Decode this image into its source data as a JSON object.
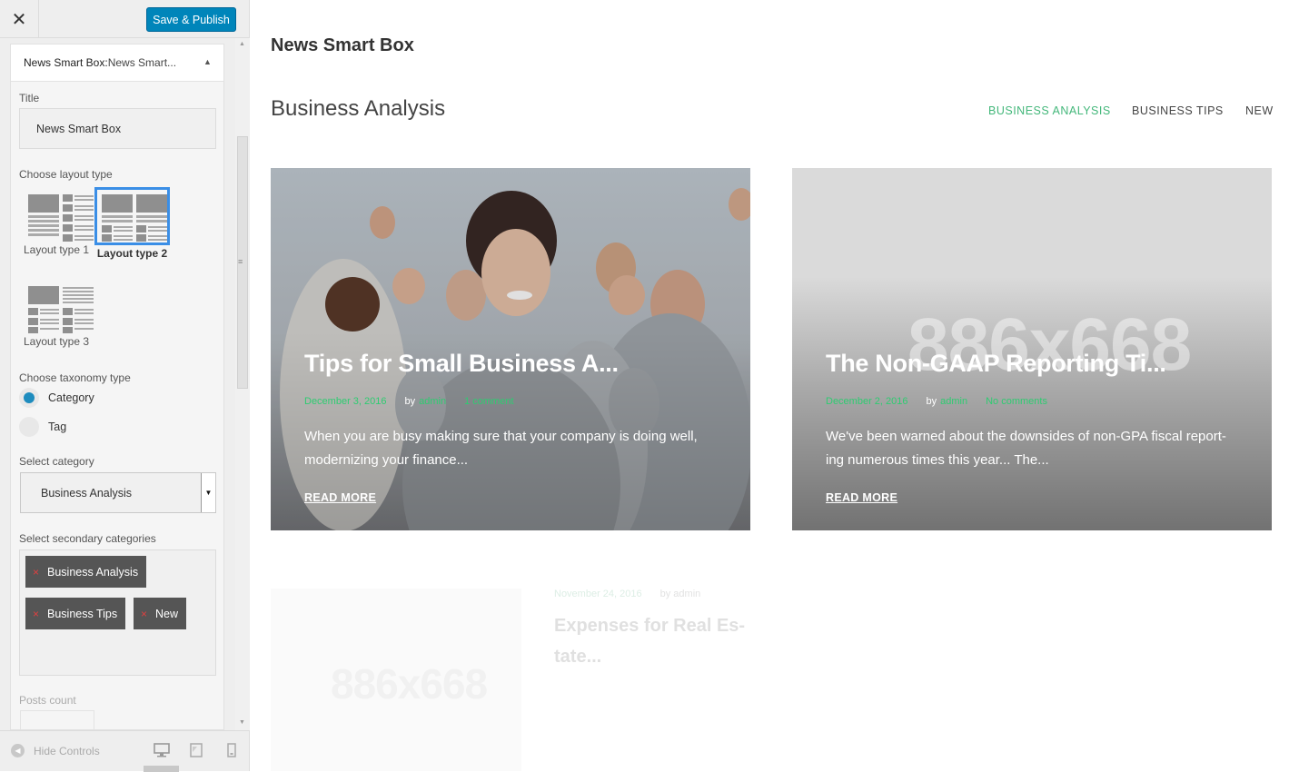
{
  "customizer": {
    "close_icon": "close-icon",
    "publish_label": "Save & Publish",
    "panel_title_bold": "News Smart Box:",
    "panel_title_rest": " News Smart...",
    "title_label": "Title",
    "title_value": "News Smart Box",
    "layout_label": "Choose layout type",
    "layouts": [
      {
        "label": "Layout type 1",
        "selected": false
      },
      {
        "label": "Layout type 2",
        "selected": true
      },
      {
        "label": "Layout type 3",
        "selected": false
      }
    ],
    "taxonomy_label": "Choose taxonomy type",
    "taxonomy_options": [
      {
        "label": "Category",
        "checked": true
      },
      {
        "label": "Tag",
        "checked": false
      }
    ],
    "category_label": "Select category",
    "category_value": "Business Analysis",
    "secondary_label": "Select secondary categories",
    "secondary_tags": [
      "Business Analysis",
      "Business Tips",
      "New"
    ],
    "posts_count_label": "Posts count",
    "hide_controls_label": "Hide Controls"
  },
  "preview": {
    "widget_title": "News Smart Box",
    "section_title": "Business Analysis",
    "tabs": [
      "BUSINESS ANALYSIS",
      "BUSINESS TIPS",
      "NEW"
    ],
    "active_tab_color": "#43b77a",
    "posts": [
      {
        "title": "Tips for Small Business A...",
        "date": "December 3, 2016",
        "by": "by",
        "author": "admin",
        "comments": "1 comment",
        "excerpt": "When you are busy making sure that your company is doing well, modernizing your finance...",
        "read_more": "READ MORE"
      },
      {
        "title": "The Non-GAAP Reporting Ti...",
        "date": "December 2, 2016",
        "by": "by",
        "author": "admin",
        "comments": "No comments",
        "excerpt": "We've been warned about the downsides of non-GPA fiscal report-ing numerous times this year... The...",
        "read_more": "READ MORE",
        "placeholder": "886x668"
      }
    ],
    "faded_post": {
      "date": "November 24, 2016",
      "by_author": "by admin",
      "title": "Expenses for Real Es-tate...",
      "placeholder": "886x668"
    }
  }
}
